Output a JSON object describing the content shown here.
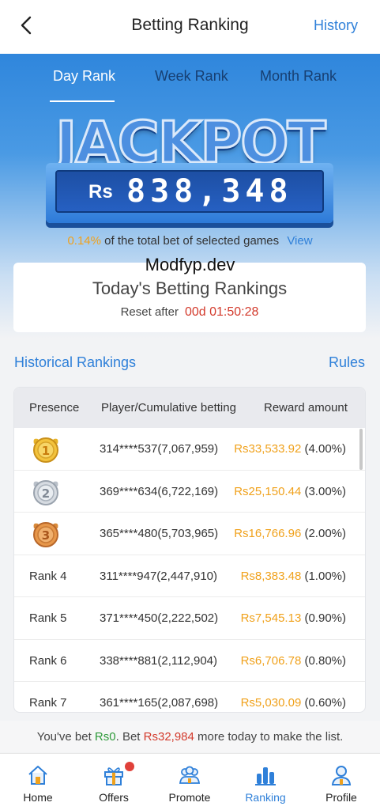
{
  "header": {
    "title": "Betting Ranking",
    "history_label": "History"
  },
  "tabs": [
    {
      "label": "Day Rank",
      "active": true
    },
    {
      "label": "Week Rank",
      "active": false
    },
    {
      "label": "Month Rank",
      "active": false
    }
  ],
  "jackpot": {
    "title": "JACKPOT",
    "currency": "Rs",
    "amount": "838,348",
    "percent": "0.14%",
    "description": "of the total bet of selected games",
    "view_label": "View"
  },
  "watermark": "Modfyp.dev",
  "today": {
    "title": "Today's Betting Rankings",
    "reset_label": "Reset after",
    "countdown": "00d 01:50:28"
  },
  "links": {
    "historical": "Historical Rankings",
    "rules": "Rules"
  },
  "table": {
    "headers": [
      "Presence",
      "Player/Cumulative betting",
      "Reward amount"
    ],
    "rows": [
      {
        "rank": "1",
        "player": "314****537(7,067,959)",
        "amount": "Rs33,533.92",
        "pct": "(4.00%)"
      },
      {
        "rank": "2",
        "player": "369****634(6,722,169)",
        "amount": "Rs25,150.44",
        "pct": "(3.00%)"
      },
      {
        "rank": "3",
        "player": "365****480(5,703,965)",
        "amount": "Rs16,766.96",
        "pct": "(2.00%)"
      },
      {
        "rank": "Rank 4",
        "player": "311****947(2,447,910)",
        "amount": "Rs8,383.48",
        "pct": "(1.00%)"
      },
      {
        "rank": "Rank 5",
        "player": "371****450(2,222,502)",
        "amount": "Rs7,545.13",
        "pct": "(0.90%)"
      },
      {
        "rank": "Rank 6",
        "player": "338****881(2,112,904)",
        "amount": "Rs6,706.78",
        "pct": "(0.80%)"
      },
      {
        "rank": "Rank 7",
        "player": "361****165(2,087,698)",
        "amount": "Rs5,030.09",
        "pct": "(0.60%)"
      }
    ]
  },
  "notice": {
    "part1": "You've bet ",
    "bet": "Rs0",
    "part2": ". Bet ",
    "needed": "Rs32,984",
    "part3": " more today to make the list."
  },
  "nav": [
    {
      "label": "Home",
      "icon": "home-icon"
    },
    {
      "label": "Offers",
      "icon": "gift-icon"
    },
    {
      "label": "Promote",
      "icon": "promote-icon"
    },
    {
      "label": "Ranking",
      "icon": "ranking-icon"
    },
    {
      "label": "Profile",
      "icon": "profile-icon"
    }
  ],
  "colors": {
    "accent": "#2f80d9",
    "gold": "#f0a11b",
    "red": "#d33a2c",
    "green": "#2e9a3a"
  }
}
